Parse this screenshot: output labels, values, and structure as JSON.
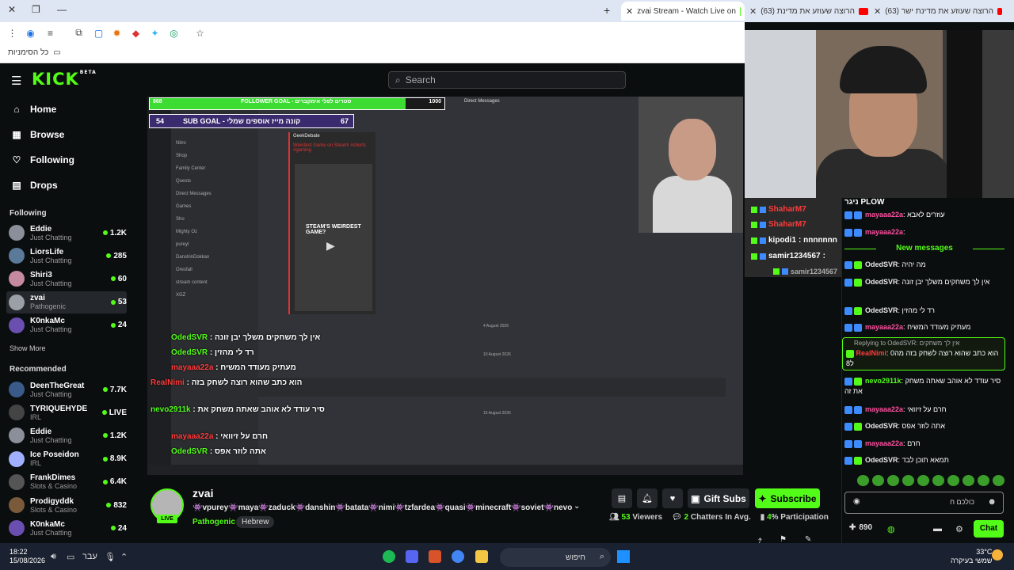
{
  "browser": {
    "tabs": [
      {
        "label": "zvai Stream - Watch Live on",
        "active": true
      },
      {
        "label": "(63) הרוצה שעוזע את מדינת",
        "active": false
      },
      {
        "label": "(63) הרוצה שעוזע את מדינת ישר",
        "active": false
      }
    ],
    "bookmarks_label": "כל הסימניות"
  },
  "kick": {
    "logo": "KICK",
    "logo_beta": "BETA",
    "search_placeholder": "Search"
  },
  "sidebar": {
    "nav": [
      {
        "label": "Home",
        "icon": "home-icon",
        "glyph": "⌂"
      },
      {
        "label": "Browse",
        "icon": "browse-icon",
        "glyph": "▦"
      },
      {
        "label": "Following",
        "icon": "heart-icon",
        "glyph": "♡"
      },
      {
        "label": "Drops",
        "icon": "drops-icon",
        "glyph": "▤"
      }
    ],
    "following_title": "Following",
    "following": [
      {
        "name": "Eddie",
        "category": "Just Chatting",
        "viewers": "1.2K",
        "color": "#8a8f99"
      },
      {
        "name": "LiorsLife",
        "category": "Just Chatting",
        "viewers": "285",
        "color": "#5b7a99"
      },
      {
        "name": "Shiri3",
        "category": "Just Chatting",
        "viewers": "60",
        "color": "#c58aa0"
      },
      {
        "name": "zvai",
        "category": "Pathogenic",
        "viewers": "53",
        "color": "#9aa0a6"
      },
      {
        "name": "K0nkaMc",
        "category": "Just Chatting",
        "viewers": "24",
        "color": "#6a4fb0"
      }
    ],
    "show_more": "Show More",
    "recommended_title": "Recommended",
    "recommended": [
      {
        "name": "DeenTheGreat",
        "category": "Just Chatting",
        "viewers": "7.7K",
        "color": "#3a5a8a"
      },
      {
        "name": "TYRIQUEHYDE",
        "category": "IRL",
        "viewers": "LIVE",
        "color": "#444"
      },
      {
        "name": "Eddie",
        "category": "Just Chatting",
        "viewers": "1.2K",
        "color": "#8a8f99"
      },
      {
        "name": "Ice Poseidon",
        "category": "IRL",
        "viewers": "8.9K",
        "color": "#a0b0ff"
      },
      {
        "name": "FrankDimes",
        "category": "Slots & Casino",
        "viewers": "6.4K",
        "color": "#555"
      },
      {
        "name": "Prodigyddk",
        "category": "Slots & Casino",
        "viewers": "832",
        "color": "#7a5a3a"
      },
      {
        "name": "K0nkaMc",
        "category": "Just Chatting",
        "viewers": "24",
        "color": "#6a4fb0"
      }
    ]
  },
  "video": {
    "follower_goal_label": "FOLLOWER GOAL - סטרים לפלי אימקברים",
    "follower_goal_current": "868",
    "follower_goal_target": "1000",
    "follower_goal_progress": 0.868,
    "sub_goal_label": "SUB GOAL - קונה מייז אוספים שמלי",
    "sub_goal_current": "54",
    "sub_goal_target": "67",
    "dm_header": "Direct Messages",
    "discord_items": [
      "Nitro",
      "Shop",
      "Family Center",
      "Quests",
      "Direct Messages",
      "Games",
      "Sho",
      "Mighty Oz",
      "pureyl",
      "DanshinDokkan",
      "Oresfall",
      "stream content",
      "XGZ"
    ],
    "thumb_user": "GeekDebate",
    "thumb_caption": "Weirdest Game on Steam! #shorts #gaming",
    "thumb_title": "STEAM'S WEIRDEST GAME?",
    "date1": "4 August 2026",
    "date2": "10 August 2026",
    "date3": "15 August 2026",
    "overlay_msgs": [
      {
        "user": "OdedSVR",
        "text": "אין לך משחקים משלך יבן זונה",
        "color": "green"
      },
      {
        "user": "OdedSVR",
        "text": "רד לי מהזין",
        "color": "green"
      },
      {
        "user": "mayaaa22a",
        "text": "מעתיק מעודד המשיח",
        "color": "red"
      },
      {
        "user": "RealNimi",
        "text": "הוא כתב שהוא רוצה לשחק בזה",
        "color": "red"
      },
      {
        "user": "nevo2911k",
        "text": "סיר עודד לא אוהב שאתה משחק את",
        "color": "green"
      },
      {
        "user": "mayaaa22a",
        "text": "חרם על זיוואי",
        "color": "red"
      },
      {
        "user": "OdedSVR",
        "text": "אתה לוזר אפס",
        "color": "green"
      }
    ]
  },
  "stream": {
    "name": "zvai",
    "live": "LIVE",
    "title": "👾vpurey👾maya👾zaduck👾danshin👾batata👾nimi👾tzfardea👾quasi👾minecraft👾soviet👾nevo...",
    "category": "Pathogenic",
    "tag": "Hebrew",
    "gift_label": "Gift Subs",
    "subscribe_label": "Subscribe",
    "viewers": "53",
    "viewers_label": "Viewers",
    "chatters": "2",
    "chatters_label": "Chatters In Avg.",
    "participation": "4",
    "participation_label": "% Participation"
  },
  "overlay_chat": [
    {
      "user": "ShaharM7",
      "text": "",
      "color": "red"
    },
    {
      "user": "ShaharM7",
      "text": "",
      "color": "red"
    },
    {
      "user": "kipodi1",
      "text": ": nnnnnnn",
      "color": "white"
    },
    {
      "user": "samir1234567",
      "text": ":",
      "color": "white"
    },
    {
      "user": "samir1234567",
      "text": "",
      "color": "gray"
    }
  ],
  "chat": {
    "header": "ניגר PLOW",
    "new_messages": "New messages",
    "messages": [
      {
        "user": "mayaaa22a",
        "text": "עוזרים לאבא",
        "color": "pink"
      },
      {
        "user": "mayaaa22a",
        "text": "",
        "color": "pink"
      },
      {
        "user": "OdedSVR",
        "text": "מה יהיה",
        "color": "white"
      },
      {
        "user": "OdedSVR",
        "text": "אין לך משחקים משלך יבן זונה",
        "color": "white"
      },
      {
        "user": "OdedSVR",
        "text": "רד לי מהזין",
        "color": "white"
      },
      {
        "user": "mayaaa22a",
        "text": "מעתיק מעודד המשיח",
        "color": "pink"
      },
      {
        "user": "nevo2911k",
        "text": "סיר עודד לא אוהב שאתה משחק את זה",
        "color": "green"
      },
      {
        "user": "mayaaa22a",
        "text": "חרם על זיוואי",
        "color": "pink"
      },
      {
        "user": "OdedSVR",
        "text": "אתה לוזר אפס",
        "color": "white"
      },
      {
        "user": "mayaaa22a",
        "text": "חרם",
        "color": "pink"
      },
      {
        "user": "OdedSVR",
        "text": "תמאא תוכן לבד",
        "color": "white"
      }
    ],
    "reply_context": "Replying to OdedSVR: אין לך משחקים",
    "reply_user": "RealNimi",
    "reply_text": "הוא כתב שהוא רוצה לשחק בזה מה0 ל8",
    "input_value": "כולכם ח",
    "points": "890",
    "chat_button": "Chat"
  },
  "taskbar": {
    "time": "18:22",
    "date": "15/08/2026",
    "lang": "עבר",
    "search_label": "חיפוש",
    "temp": "33°C",
    "weather": "שמשי בעיקרה"
  },
  "colors": {
    "accent": "#53fc18",
    "bg": "#0b0e0f"
  }
}
